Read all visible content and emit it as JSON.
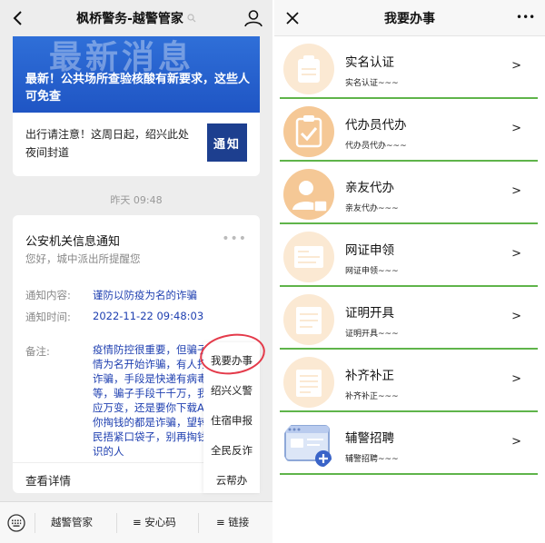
{
  "left": {
    "title": "枫桥警务-越警管家",
    "banner_big_text": "最新消息",
    "banner_headline": "最新！公共场所查验核酸有新要求，这些人可免查",
    "news_text": "出行请注意！这周日起，绍兴此处夜间封道",
    "news_thumb_text": "通知",
    "timestamp": "昨天 09:48",
    "notice": {
      "title": "公安机关信息通知",
      "subtitle": "您好，城中派出所提醒您",
      "content_label": "通知内容:",
      "content_value": "谨防以防疫为名的诈骗",
      "time_label": "通知时间:",
      "time_value": "2022-11-22 09:48:03",
      "note_label": "备注:",
      "note_value": "疫情防控很重要，但骗子\n情为名开始诈骗，有人打\n诈骗，手段是快递有病毒\n等，骗子手段千千万，我\n应万变，还是要你下载A\n你掏钱的都是诈骗，望转\n民捂紧口袋子，别再掏钱\n识的人",
      "footer": "查看详情"
    },
    "popup_menu": [
      "我要办事",
      "绍兴义警",
      "住宿申报",
      "全民反诈",
      "云帮办"
    ],
    "bottom_bar": [
      "越警管家",
      "安心码",
      "链接"
    ]
  },
  "right": {
    "title": "我要办事",
    "more": "•••",
    "items": [
      {
        "title": "实名认证",
        "sub": "实名认证~~~",
        "icon": "id-card-icon"
      },
      {
        "title": "代办员代办",
        "sub": "代办员代办~~~",
        "icon": "clipboard-check-icon"
      },
      {
        "title": "亲友代办",
        "sub": "亲友代办~~~",
        "icon": "user-icon"
      },
      {
        "title": "网证申领",
        "sub": "网证申领~~~",
        "icon": "document-icon"
      },
      {
        "title": "证明开具",
        "sub": "证明开具~~~",
        "icon": "certificate-icon"
      },
      {
        "title": "补齐补正",
        "sub": "补齐补正~~~",
        "icon": "form-icon"
      },
      {
        "title": "辅警招聘",
        "sub": "辅警招聘~~~",
        "icon": "recruit-browser-icon"
      }
    ],
    "arrow": ">"
  },
  "colors": {
    "accent_blue": "#1e3fb0",
    "banner_blue": "#2f6fd8",
    "icon_orange": "#f5c896",
    "icon_pale": "#fbe9d3",
    "row_line_green": "#5fb44a",
    "highlight_red": "#e43a4a"
  }
}
